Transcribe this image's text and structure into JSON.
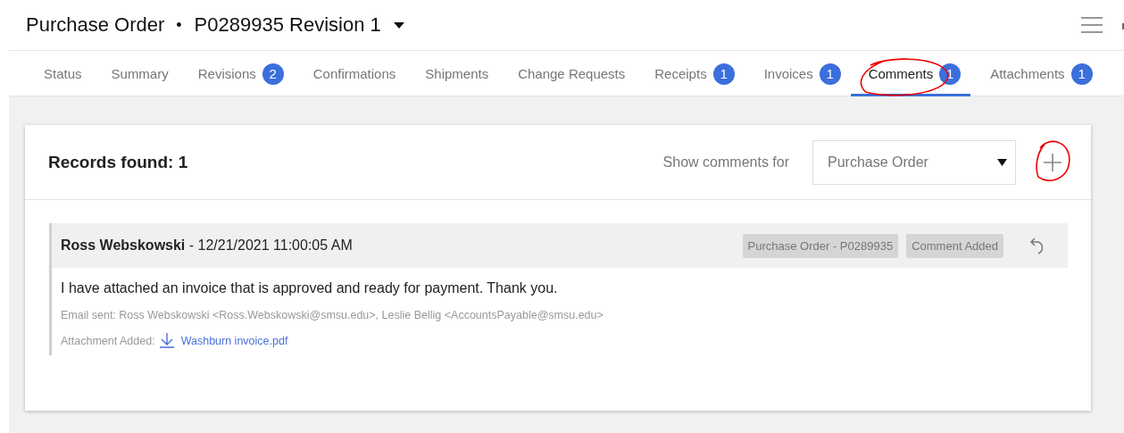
{
  "header": {
    "title": "Purchase Order",
    "separator": "•",
    "document": "P0289935 Revision 1"
  },
  "tabs": [
    {
      "label": "Status",
      "selected": false,
      "circled": false
    },
    {
      "label": "Summary",
      "selected": false,
      "circled": false
    },
    {
      "label": "Revisions",
      "badge": "2",
      "selected": false,
      "circled": false
    },
    {
      "label": "Confirmations",
      "selected": false,
      "circled": false
    },
    {
      "label": "Shipments",
      "selected": false,
      "circled": false
    },
    {
      "label": "Change Requests",
      "selected": false,
      "circled": false
    },
    {
      "label": "Receipts",
      "badge": "1",
      "selected": false,
      "circled": false
    },
    {
      "label": "Invoices",
      "badge": "1",
      "selected": false,
      "circled": false
    },
    {
      "label": "Comments",
      "badge": "1",
      "selected": true,
      "circled": true
    },
    {
      "label": "Attachments",
      "badge": "1",
      "selected": false,
      "circled": false
    }
  ],
  "panel": {
    "records_found": "Records found: 1",
    "filter_label": "Show comments for",
    "filter_value": "Purchase Order",
    "add_circled": true,
    "comments": [
      {
        "author": "Ross Webskowski",
        "timestamp": "- 12/21/2021 11:00:05 AM",
        "tags": [
          "Purchase Order - P0289935",
          "Comment Added"
        ],
        "body": "I have attached an invoice that is approved and ready for payment. Thank you.",
        "email": "Email sent: Ross Webskowski <Ross.Webskowski@smsu.edu>, Leslie Bellig <AccountsPayable@smsu.edu>",
        "attachment_label": "Attachment Added:",
        "attachment": "Washburn invoice.pdf"
      }
    ]
  }
}
